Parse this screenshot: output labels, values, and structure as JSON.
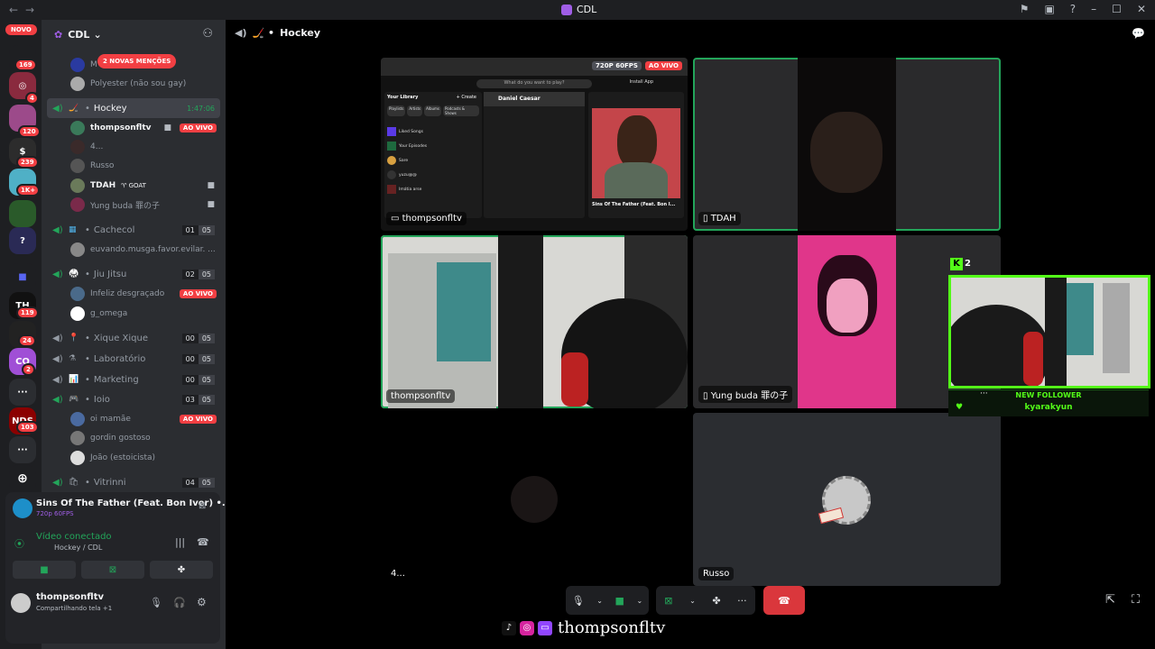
{
  "window": {
    "title": "CDL"
  },
  "rail": {
    "new_label": "NOVO",
    "badges": [
      "169",
      "4",
      "120",
      "239",
      "1K+",
      "119",
      "24",
      "2",
      "103"
    ]
  },
  "server": {
    "name": "CDL",
    "mentions_banner": "2 NOVAS MENÇÕES"
  },
  "channels": {
    "partial_user": "M",
    "polyester": "Polyester (não sou gay)",
    "hockey": {
      "name": "Hockey",
      "timer": "1:47:06"
    },
    "hockey_users": [
      {
        "name": "thompsonfltv",
        "status": "AO VIVO"
      },
      {
        "name": "4..."
      },
      {
        "name": "Russo"
      },
      {
        "name": "TDAH",
        "tag": "GOAT"
      },
      {
        "name": "Yung buda 罪の子"
      }
    ],
    "cachecol": {
      "name": "Cachecol",
      "count": "01",
      "limit": "05"
    },
    "cachecol_user": "euvando.musga.favor.evilar. ...",
    "jiu": {
      "name": "Jiu Jitsu",
      "count": "02",
      "limit": "05"
    },
    "jiu_users": [
      {
        "name": "Infeliz desgraçado",
        "status": "AO VIVO"
      },
      {
        "name": "g_omega"
      }
    ],
    "xique": {
      "name": "Xique Xique",
      "count": "00",
      "limit": "05"
    },
    "lab": {
      "name": "Laboratório",
      "count": "00",
      "limit": "05"
    },
    "marketing": {
      "name": "Marketing",
      "count": "00",
      "limit": "05"
    },
    "ioio": {
      "name": "Ioio",
      "count": "03",
      "limit": "05"
    },
    "ioio_users": [
      {
        "name": "oi mamãe",
        "status": "AO VIVO"
      },
      {
        "name": "gordin gostoso"
      },
      {
        "name": "João (estoicista)"
      }
    ],
    "vitrinni": {
      "name": "Vitrinni",
      "count": "04",
      "limit": "05"
    }
  },
  "activity": {
    "title": "Sins Of The Father (Feat. Bon Iver) •...",
    "quality": "720p 60FPS"
  },
  "voice": {
    "status": "Vídeo conectado",
    "location": "Hockey / CDL"
  },
  "account": {
    "name": "thompsonfltv",
    "status": "Compartilhando tela +1"
  },
  "main": {
    "channel": "Hockey"
  },
  "stream": {
    "badge_fps": "720P 60FPS",
    "badge_live": "AO VIVO",
    "owner": "thompsonfltv",
    "spotify": {
      "search": "What do you want to play?",
      "library": "Your Library",
      "create": "+ Create",
      "tabs": [
        "Playlists",
        "Artists",
        "Albums",
        "Podcasts & Shows"
      ],
      "items": [
        "Liked Songs",
        "Your Episodes",
        "Sare",
        "yuzu@@",
        "Imátia arse"
      ],
      "artist": "Daniel Caesar",
      "song": "Sins Of The Father (Feat. Bon I...",
      "install": "Install App"
    }
  },
  "tiles": {
    "tdah": "TDAH",
    "cam": "thompsonfltv",
    "yung": "Yung buda 罪の子",
    "four": "4...",
    "russo": "Russo"
  },
  "overlay": {
    "count": "2",
    "new_follower": "NEW FOLLOWER",
    "follower": "kyarakyun"
  },
  "socials": {
    "handle": "thompsonfltv"
  }
}
